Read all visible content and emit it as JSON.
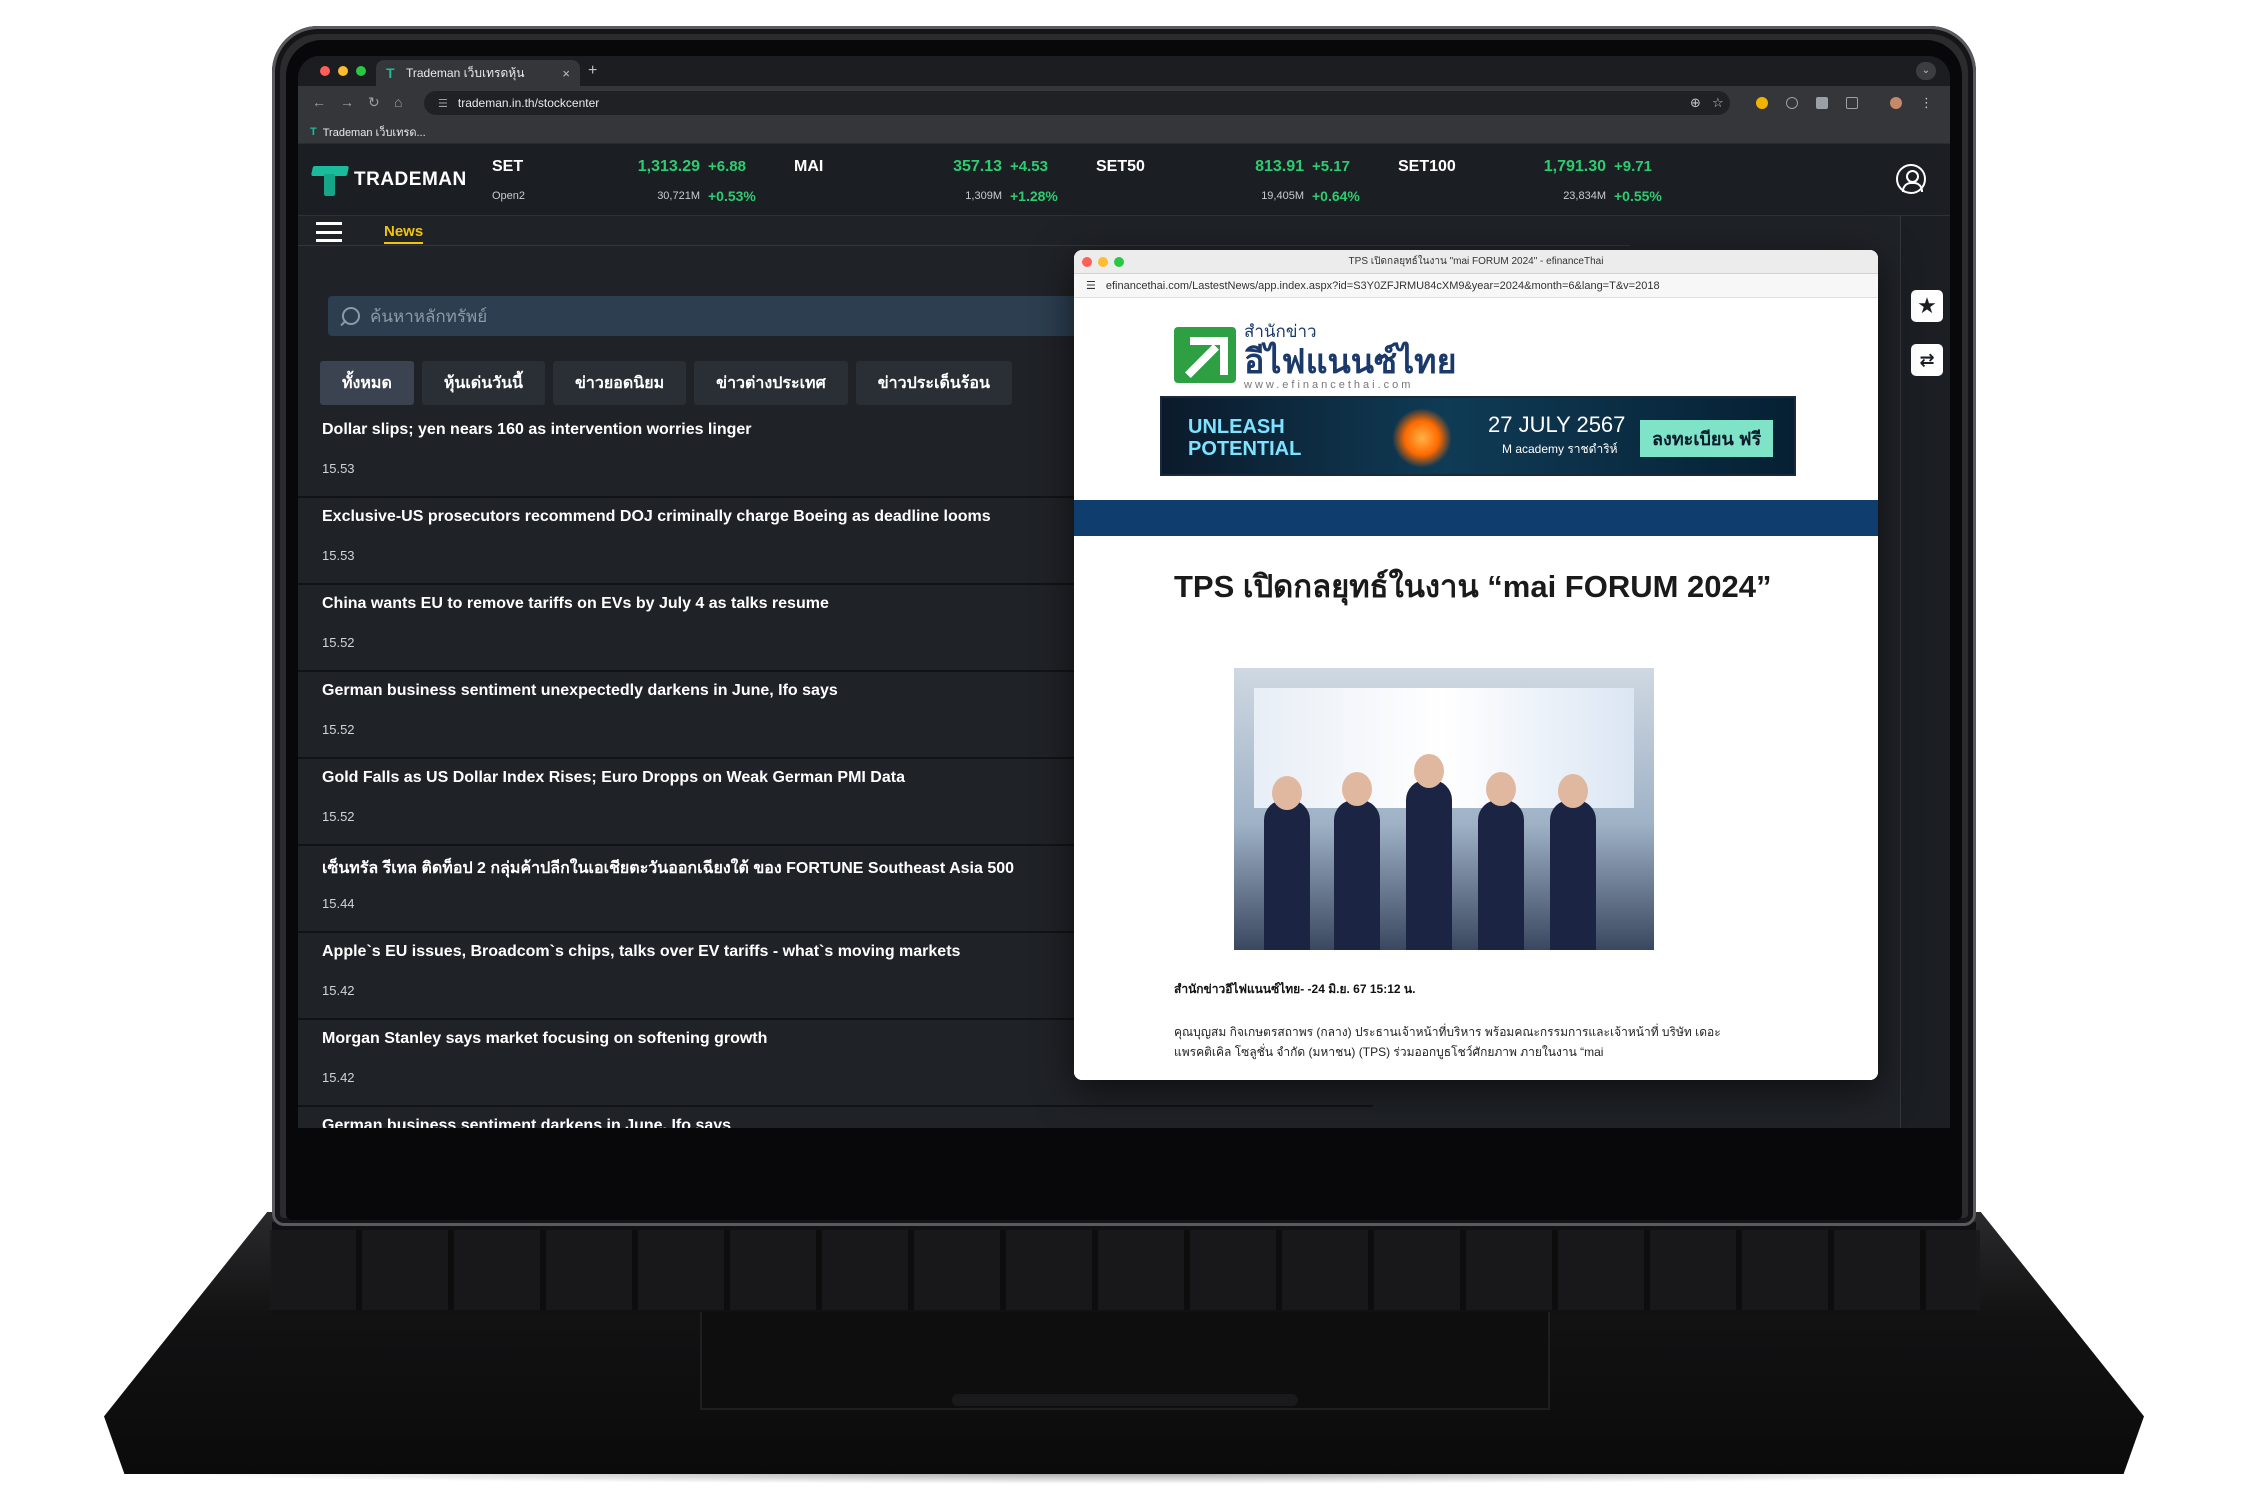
{
  "browser": {
    "tab_title": "Trademan เว็บเทรดหุ้น",
    "tab_close": "×",
    "new_tab": "+",
    "tab_menu": "⌄",
    "url": "trademan.in.th/stockcenter",
    "bookmark": "Trademan เว็บเทรด..."
  },
  "brand": {
    "name": "TRADEMAN"
  },
  "indices": [
    {
      "name": "SET",
      "sub": "Open2",
      "value": "1,313.29",
      "change": "+6.88",
      "volume": "30,721M",
      "pct": "+0.53%"
    },
    {
      "name": "MAI",
      "sub": "",
      "value": "357.13",
      "change": "+4.53",
      "volume": "1,309M",
      "pct": "+1.28%"
    },
    {
      "name": "SET50",
      "sub": "",
      "value": "813.91",
      "change": "+5.17",
      "volume": "19,405M",
      "pct": "+0.64%"
    },
    {
      "name": "SET100",
      "sub": "",
      "value": "1,791.30",
      "change": "+9.71",
      "volume": "23,834M",
      "pct": "+0.55%"
    }
  ],
  "subnav": {
    "news_label": "News"
  },
  "search": {
    "placeholder": "ค้นหาหลักทรัพย์"
  },
  "filters": [
    "ทั้งหมด",
    "หุ้นเด่นวันนี้",
    "ข่าวยอดนิยม",
    "ข่าวต่างประเทศ",
    "ข่าวประเด็นร้อน"
  ],
  "news": [
    {
      "title": "Dollar slips; yen nears 160 as intervention worries linger",
      "time": "15.53"
    },
    {
      "title": "Exclusive-US prosecutors recommend DOJ criminally charge Boeing as deadline looms",
      "time": "15.53"
    },
    {
      "title": "China wants EU to remove tariffs on EVs by July 4 as talks resume",
      "time": "15.52"
    },
    {
      "title": "German business sentiment unexpectedly darkens in June, Ifo says",
      "time": "15.52"
    },
    {
      "title": "Gold Falls as US Dollar Index Rises; Euro Dropps on Weak German PMI Data",
      "time": "15.52"
    },
    {
      "title": "เซ็นทรัล รีเทล ติดท็อป 2 กลุ่มค้าปลีกในเอเชียตะวันออกเฉียงใต้ ของ FORTUNE Southeast Asia 500",
      "time": "15.44"
    },
    {
      "title": "Apple`s EU issues, Broadcom`s chips, talks over EV tariffs - what`s moving markets",
      "time": "15.42"
    },
    {
      "title": "Morgan Stanley says market focusing on softening growth",
      "time": "15.42"
    },
    {
      "title": "German business sentiment darkens in June, Ifo says",
      "time": ""
    }
  ],
  "popup": {
    "window_title": "TPS เปิดกลยุทธ์ในงาน \"mai FORUM 2024\" - efinanceThai",
    "url": "efinancethai.com/LastestNews/app.index.aspx?id=S3Y0ZFJRMU84cXM9&year=2024&month=6&lang=T&v=2018",
    "logo_small": "สำนักข่าว",
    "logo_big": "อีไฟแนนซ์ไทย",
    "logo_url": "www.efinancethai.com",
    "banner_line1": "UNLEASH",
    "banner_line2": "POTENTIAL",
    "banner_date": "27 JULY 2567",
    "banner_venue": "M academy ราชดำริห์",
    "banner_cta": "ลงทะเบียน ฟรี",
    "article_title": "TPS เปิดกลยุทธ์ในงาน “mai FORUM 2024”",
    "byline": "สำนักข่าวอีไฟแนนซ์ไทย- -24 มิ.ย. 67 15:12 น.",
    "paragraph": "คุณบุญสม กิจเกษตรสถาพร (กลาง) ประธานเจ้าหน้าที่บริหาร พร้อมคณะกรรมการและเจ้าหน้าที่ บริษัท เดอะแพรคติเคิล โซลูชั่น จำกัด (มหาชน) (TPS) ร่วมออกบูธโชว์ศักยภาพ ภายในงาน “mai"
  },
  "colors": {
    "accent": "#1abc9c",
    "up": "#2ecc71",
    "news_tab": "#f1c40f"
  }
}
